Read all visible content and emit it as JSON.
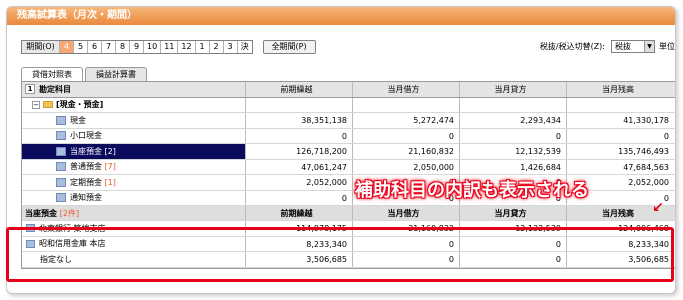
{
  "window": {
    "title": "残高試算表（月次・期間）"
  },
  "toolbar": {
    "period_label": "期間(O)",
    "months": [
      "4",
      "5",
      "6",
      "7",
      "8",
      "9",
      "10",
      "11",
      "12",
      "1",
      "2",
      "3",
      "決"
    ],
    "active_month": "4",
    "all_period_button": "全期間(P)",
    "tax_label": "税抜/税込切替(Z):",
    "tax_value": "税抜",
    "unit_label": "単位"
  },
  "tabs": [
    {
      "label": "貸借対照表",
      "active": true
    },
    {
      "label": "損益計算書",
      "active": false
    }
  ],
  "grid": {
    "row_num": "1",
    "headers": [
      "勘定科目",
      "前期繰越",
      "当月借方",
      "当月貸方",
      "当月残高"
    ],
    "group": {
      "label": "[現金・預金]"
    },
    "rows": [
      {
        "name": "現金",
        "suffix": "",
        "values": [
          "38,351,138",
          "5,272,474",
          "2,293,434",
          "41,330,178"
        ]
      },
      {
        "name": "小口現金",
        "suffix": "",
        "values": [
          "0",
          "0",
          "0",
          "0"
        ]
      },
      {
        "name": "当座預金",
        "suffix": "[2]",
        "values": [
          "126,718,200",
          "21,160,832",
          "12,132,539",
          "135,746,493"
        ],
        "selected": true
      },
      {
        "name": "普通預金",
        "suffix": "[7]",
        "values": [
          "47,061,247",
          "2,050,000",
          "1,426,684",
          "47,684,563"
        ]
      },
      {
        "name": "定期預金",
        "suffix": "[1]",
        "values": [
          "2,052,000",
          "0",
          "0",
          "2,052,000"
        ]
      },
      {
        "name": "通知預金",
        "suffix": "",
        "values": [
          "0",
          "0",
          "0",
          "0"
        ]
      }
    ],
    "sub_header": {
      "title": "当座預金",
      "count": "[2件]",
      "columns": [
        "前期繰越",
        "当月借方",
        "当月貸方",
        "当月残高"
      ]
    },
    "sub_rows": [
      {
        "name": "北東銀行 築地支店",
        "values": [
          "114,978,175",
          "21,160,832",
          "12,132,539",
          "124,006,468"
        ],
        "icon": true
      },
      {
        "name": "昭和信用金庫 本店",
        "values": [
          "8,233,340",
          "0",
          "0",
          "8,233,340"
        ],
        "icon": true
      },
      {
        "name": "指定なし",
        "values": [
          "3,506,685",
          "0",
          "0",
          "3,506,685"
        ],
        "icon": false
      }
    ]
  },
  "annotation": {
    "text": "補助科目の内訳も表示される",
    "color": "#e8001b"
  }
}
